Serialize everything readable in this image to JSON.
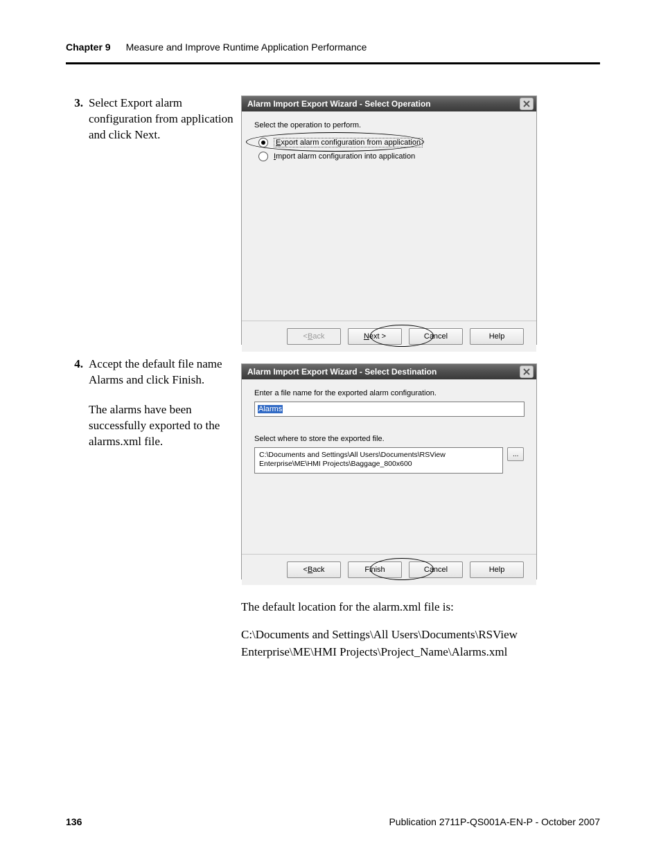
{
  "header": {
    "chapter": "Chapter 9",
    "title": "Measure and Improve Runtime Application Performance"
  },
  "footer": {
    "page": "136",
    "pub": "Publication 2711P-QS001A-EN-P - October 2007"
  },
  "step3": {
    "num": "3.",
    "text": "Select Export alarm configuration from application and click Next."
  },
  "step4": {
    "num": "4.",
    "text": "Accept the default file name Alarms and click Finish.",
    "followup": "The alarms have been successfully exported to the alarms.xml file."
  },
  "bodytext": {
    "l1": "The default location for the alarm.xml file is:",
    "l2": "C:\\Documents and Settings\\All Users\\Documents\\RSView Enterprise\\ME\\HMI Projects\\Project_Name\\Alarms.xml"
  },
  "dialog1": {
    "title": "Alarm Import Export Wizard - Select Operation",
    "prompt": "Select the operation to perform.",
    "opt1_pre": "E",
    "opt1_rest": "xport alarm configuration from application",
    "opt2_pre": "I",
    "opt2_rest": "mport alarm configuration into application",
    "back_pre": "< ",
    "back_u": "B",
    "back_rest": "ack",
    "next_u": "N",
    "next_rest": "ext >",
    "cancel": "Cancel",
    "help": "Help"
  },
  "dialog2": {
    "title": "Alarm Import Export Wizard - Select Destination",
    "prompt1": "Enter a file name for the exported alarm configuration.",
    "filename": "Alarms",
    "prompt2": "Select where to store the exported file.",
    "path": "C:\\Documents and Settings\\All Users\\Documents\\RSView Enterprise\\ME\\HMI Projects\\Baggage_800x600",
    "browse": "...",
    "back_pre": "< ",
    "back_u": "B",
    "back_rest": "ack",
    "finish": "Finish",
    "cancel": "Cancel",
    "help": "Help"
  }
}
